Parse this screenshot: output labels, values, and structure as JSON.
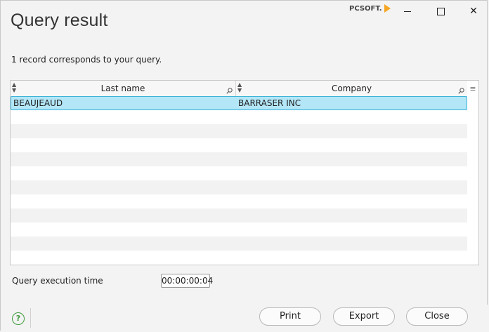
{
  "window": {
    "title": "Query result",
    "brand": "PCSOFT.",
    "min_icon": "minimize-icon",
    "max_icon": "maximize-icon",
    "close_icon": "close-icon"
  },
  "info_text": "1 record corresponds to your query.",
  "grid": {
    "columns": [
      {
        "label": "Last name",
        "sort_icon": "sort-icon",
        "search_icon": "search-icon"
      },
      {
        "label": "Company",
        "sort_icon": "sort-icon",
        "search_icon": "search-icon"
      }
    ],
    "rows": [
      {
        "last_name": "BEAUJEAUD",
        "company": "BARRASER INC"
      }
    ],
    "menu_icon": "menu-icon"
  },
  "execution": {
    "label": "Query execution time",
    "value": "00:00:00:04"
  },
  "footer": {
    "help_icon": "help-icon",
    "print_label": "Print",
    "export_label": "Export",
    "close_label": "Close"
  },
  "colors": {
    "selection_bg": "#b3e6f7",
    "selection_border": "#3db3d8",
    "help_green": "#3e9b3e",
    "brand_orange": "#f5a623"
  }
}
